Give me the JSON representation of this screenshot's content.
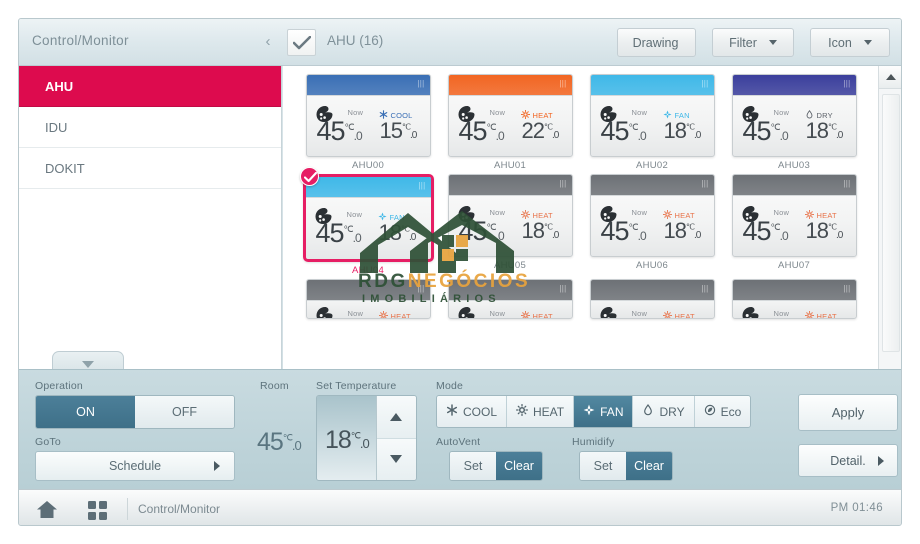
{
  "topbar": {
    "title": "Control/Monitor",
    "collapse_icon": "chevron-left-icon",
    "check_icon": "check-icon",
    "group_label": "AHU (16)",
    "buttons": [
      {
        "label": "Drawing",
        "name": "drawing-button",
        "caret": false
      },
      {
        "label": "Filter",
        "name": "filter-button",
        "caret": true
      },
      {
        "label": "Icon",
        "name": "icon-button",
        "caret": true
      }
    ]
  },
  "sidebar": {
    "items": [
      {
        "label": "AHU",
        "active": true
      },
      {
        "label": "IDU",
        "active": false
      },
      {
        "label": "DOKIT",
        "active": false
      }
    ],
    "collapse_tab_icon": "chevron-down-icon"
  },
  "grid": {
    "scroll_up_icon": "caret-up-icon",
    "cards": [
      {
        "name": "AHU00",
        "header_color": "#3a6fb5",
        "fan_icon": "fan-icon",
        "now_label": "Now",
        "now_temp": "45",
        "now_dec": ".0",
        "unit": "℃",
        "mode": "COOL",
        "mode_icon": "snowflake-icon",
        "mode_color": "#3a6fb5",
        "set_temp": "15",
        "set_dec": ".0",
        "selected": false,
        "on": true
      },
      {
        "name": "AHU01",
        "header_color": "#f26522",
        "fan_icon": "fan-icon",
        "now_label": "Now",
        "now_temp": "45",
        "now_dec": ".0",
        "unit": "℃",
        "mode": "HEAT",
        "mode_icon": "sun-icon",
        "mode_color": "#f26522",
        "set_temp": "22",
        "set_dec": ".0",
        "selected": false,
        "on": true
      },
      {
        "name": "AHU02",
        "header_color": "#3fb8e8",
        "fan_icon": "fan-icon",
        "now_label": "Now",
        "now_temp": "45",
        "now_dec": ".0",
        "unit": "℃",
        "mode": "FAN",
        "mode_icon": "fan-blade-icon",
        "mode_color": "#3fb8e8",
        "set_temp": "18",
        "set_dec": ".0",
        "selected": false,
        "on": true
      },
      {
        "name": "AHU03",
        "header_color": "#3b3f9c",
        "fan_icon": "fan-icon",
        "now_label": "Now",
        "now_temp": "45",
        "now_dec": ".0",
        "unit": "℃",
        "mode": "DRY",
        "mode_icon": "droplet-icon",
        "mode_color": "#5a6068",
        "set_temp": "18",
        "set_dec": ".0",
        "selected": false,
        "on": true
      },
      {
        "name": "AHU04",
        "header_color": "#3fb8e8",
        "fan_icon": "fan-icon",
        "now_label": "Now",
        "now_temp": "45",
        "now_dec": ".0",
        "unit": "℃",
        "mode": "FAN",
        "mode_icon": "fan-blade-icon",
        "mode_color": "#3fb8e8",
        "set_temp": "18",
        "set_dec": ".0",
        "selected": true,
        "on": true
      },
      {
        "name": "AHU05",
        "header_color": "#6d7176",
        "fan_icon": "fan-icon",
        "now_label": "Now",
        "now_temp": "45",
        "now_dec": ".0",
        "unit": "℃",
        "mode": "HEAT",
        "mode_icon": "sun-icon",
        "mode_color": "#e8734a",
        "set_temp": "18",
        "set_dec": ".0",
        "selected": false,
        "on": false
      },
      {
        "name": "AHU06",
        "header_color": "#6d7176",
        "fan_icon": "fan-icon",
        "now_label": "Now",
        "now_temp": "45",
        "now_dec": ".0",
        "unit": "℃",
        "mode": "HEAT",
        "mode_icon": "sun-icon",
        "mode_color": "#e8734a",
        "set_temp": "18",
        "set_dec": ".0",
        "selected": false,
        "on": false
      },
      {
        "name": "AHU07",
        "header_color": "#6d7176",
        "fan_icon": "fan-icon",
        "now_label": "Now",
        "now_temp": "45",
        "now_dec": ".0",
        "unit": "℃",
        "mode": "HEAT",
        "mode_icon": "sun-icon",
        "mode_color": "#e8734a",
        "set_temp": "18",
        "set_dec": ".0",
        "selected": false,
        "on": false
      }
    ],
    "partial_row": [
      {
        "header_color": "#6d7176",
        "now_label": "Now",
        "mode": "HEAT",
        "mode_color": "#e8734a"
      },
      {
        "header_color": "#6d7176",
        "now_label": "Now",
        "mode": "HEAT",
        "mode_color": "#e8734a"
      },
      {
        "header_color": "#6d7176",
        "now_label": "Now",
        "mode": "HEAT",
        "mode_color": "#e8734a"
      },
      {
        "header_color": "#6d7176",
        "now_label": "Now",
        "mode": "HEAT",
        "mode_color": "#e8734a"
      }
    ]
  },
  "controls": {
    "operation_label": "Operation",
    "operation_on": "ON",
    "operation_off": "OFF",
    "operation_selected": "ON",
    "goto_label": "GoTo",
    "schedule_label": "Schedule",
    "room_label": "Room",
    "room_value": "45",
    "room_dec": ".0",
    "unit": "℃",
    "settemp_label": "Set Temperature",
    "settemp_value": "18",
    "settemp_dec": ".0",
    "stepper_up_icon": "caret-up-icon",
    "stepper_down_icon": "caret-down-icon",
    "mode_label": "Mode",
    "modes": [
      {
        "label": "COOL",
        "icon": "snowflake-icon",
        "selected": false
      },
      {
        "label": "HEAT",
        "icon": "sun-icon",
        "selected": false
      },
      {
        "label": "FAN",
        "icon": "fan-blade-icon",
        "selected": true
      },
      {
        "label": "DRY",
        "icon": "droplet-icon",
        "selected": false
      },
      {
        "label": "Eco",
        "icon": "eco-icon",
        "selected": false
      }
    ],
    "autovent_label": "AutoVent",
    "autovent_set": "Set",
    "autovent_clear": "Clear",
    "autovent_selected": "Clear",
    "humidify_label": "Humidify",
    "humidify_set": "Set",
    "humidify_clear": "Clear",
    "humidify_selected": "Clear",
    "apply_label": "Apply",
    "detail_label": "Detail."
  },
  "statusbar": {
    "home_icon": "home-icon",
    "grid_icon": "grid-icon",
    "breadcrumb": "Control/Monitor",
    "time": "PM 01:46"
  },
  "watermark": {
    "line1_part1": "RDG",
    "line1_part2": "NEGÓCIOS",
    "line2": "IMOBILIÁRIOS"
  },
  "colors": {
    "accent_pink": "#dd0b4e",
    "selected_pink": "#e61e64",
    "panel_blue": "#3e7088",
    "cool": "#3a6fb5",
    "heat": "#f26522",
    "fan": "#3fb8e8",
    "dry": "#3b3f9c",
    "off_gray": "#6d7176"
  }
}
